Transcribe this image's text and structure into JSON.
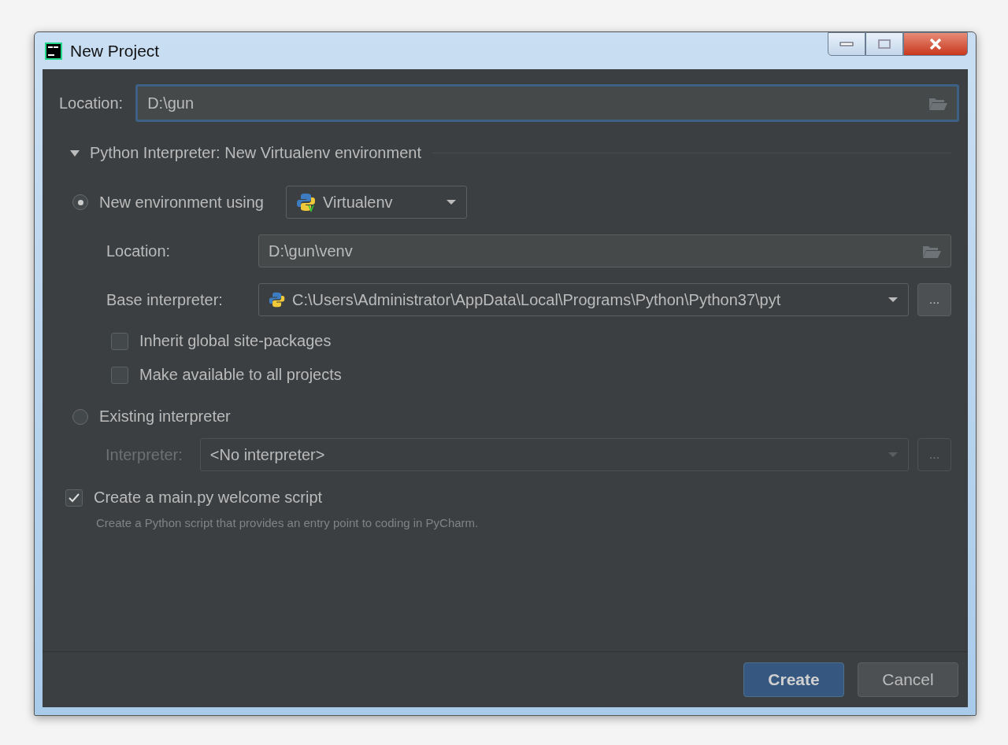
{
  "window": {
    "title": "New Project"
  },
  "location": {
    "label": "Location:",
    "value": "D:\\gun"
  },
  "interpreter_section": {
    "title": "Python Interpreter: New Virtualenv environment",
    "expanded": true
  },
  "new_environment": {
    "label": "New environment using",
    "selected": true,
    "tool": "Virtualenv",
    "location": {
      "label": "Location:",
      "value": "D:\\gun\\venv"
    },
    "base_interpreter": {
      "label": "Base interpreter:",
      "value": "C:\\Users\\Administrator\\AppData\\Local\\Programs\\Python\\Python37\\pyt",
      "more": "..."
    },
    "options": [
      {
        "label": "Inherit global site-packages",
        "checked": false
      },
      {
        "label": "Make available to all projects",
        "checked": false
      }
    ]
  },
  "existing_interpreter": {
    "label": "Existing interpreter",
    "selected": false,
    "interpreter": {
      "label": "Interpreter:",
      "value": "<No interpreter>",
      "disabled": true,
      "more": "..."
    }
  },
  "welcome_script": {
    "label": "Create a main.py welcome script",
    "checked": true,
    "description": "Create a Python script that provides an entry point to coding in PyCharm."
  },
  "buttons": [
    {
      "label": "Create",
      "kind": "primary"
    },
    {
      "label": "Cancel",
      "kind": "secondary"
    }
  ]
}
